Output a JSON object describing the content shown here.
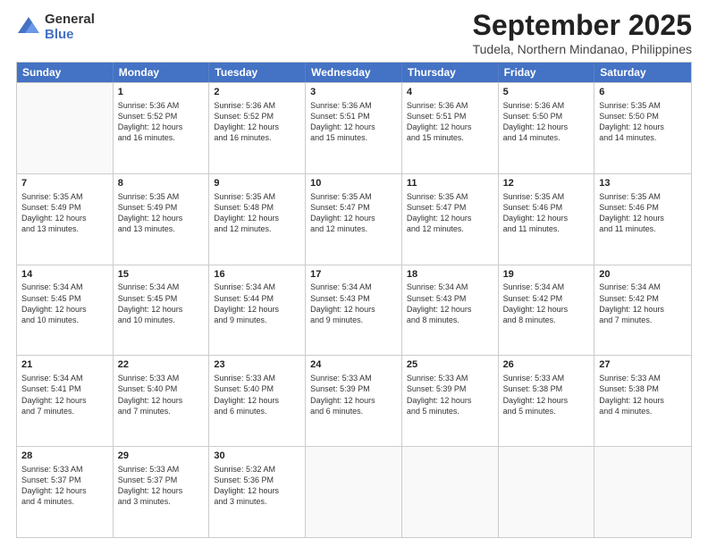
{
  "header": {
    "logo": {
      "line1": "General",
      "line2": "Blue"
    },
    "title": "September 2025",
    "subtitle": "Tudela, Northern Mindanao, Philippines"
  },
  "calendar": {
    "days_of_week": [
      "Sunday",
      "Monday",
      "Tuesday",
      "Wednesday",
      "Thursday",
      "Friday",
      "Saturday"
    ],
    "rows": [
      [
        {
          "day": "",
          "info": ""
        },
        {
          "day": "1",
          "info": "Sunrise: 5:36 AM\nSunset: 5:52 PM\nDaylight: 12 hours\nand 16 minutes."
        },
        {
          "day": "2",
          "info": "Sunrise: 5:36 AM\nSunset: 5:52 PM\nDaylight: 12 hours\nand 16 minutes."
        },
        {
          "day": "3",
          "info": "Sunrise: 5:36 AM\nSunset: 5:51 PM\nDaylight: 12 hours\nand 15 minutes."
        },
        {
          "day": "4",
          "info": "Sunrise: 5:36 AM\nSunset: 5:51 PM\nDaylight: 12 hours\nand 15 minutes."
        },
        {
          "day": "5",
          "info": "Sunrise: 5:36 AM\nSunset: 5:50 PM\nDaylight: 12 hours\nand 14 minutes."
        },
        {
          "day": "6",
          "info": "Sunrise: 5:35 AM\nSunset: 5:50 PM\nDaylight: 12 hours\nand 14 minutes."
        }
      ],
      [
        {
          "day": "7",
          "info": "Sunrise: 5:35 AM\nSunset: 5:49 PM\nDaylight: 12 hours\nand 13 minutes."
        },
        {
          "day": "8",
          "info": "Sunrise: 5:35 AM\nSunset: 5:49 PM\nDaylight: 12 hours\nand 13 minutes."
        },
        {
          "day": "9",
          "info": "Sunrise: 5:35 AM\nSunset: 5:48 PM\nDaylight: 12 hours\nand 12 minutes."
        },
        {
          "day": "10",
          "info": "Sunrise: 5:35 AM\nSunset: 5:47 PM\nDaylight: 12 hours\nand 12 minutes."
        },
        {
          "day": "11",
          "info": "Sunrise: 5:35 AM\nSunset: 5:47 PM\nDaylight: 12 hours\nand 12 minutes."
        },
        {
          "day": "12",
          "info": "Sunrise: 5:35 AM\nSunset: 5:46 PM\nDaylight: 12 hours\nand 11 minutes."
        },
        {
          "day": "13",
          "info": "Sunrise: 5:35 AM\nSunset: 5:46 PM\nDaylight: 12 hours\nand 11 minutes."
        }
      ],
      [
        {
          "day": "14",
          "info": "Sunrise: 5:34 AM\nSunset: 5:45 PM\nDaylight: 12 hours\nand 10 minutes."
        },
        {
          "day": "15",
          "info": "Sunrise: 5:34 AM\nSunset: 5:45 PM\nDaylight: 12 hours\nand 10 minutes."
        },
        {
          "day": "16",
          "info": "Sunrise: 5:34 AM\nSunset: 5:44 PM\nDaylight: 12 hours\nand 9 minutes."
        },
        {
          "day": "17",
          "info": "Sunrise: 5:34 AM\nSunset: 5:43 PM\nDaylight: 12 hours\nand 9 minutes."
        },
        {
          "day": "18",
          "info": "Sunrise: 5:34 AM\nSunset: 5:43 PM\nDaylight: 12 hours\nand 8 minutes."
        },
        {
          "day": "19",
          "info": "Sunrise: 5:34 AM\nSunset: 5:42 PM\nDaylight: 12 hours\nand 8 minutes."
        },
        {
          "day": "20",
          "info": "Sunrise: 5:34 AM\nSunset: 5:42 PM\nDaylight: 12 hours\nand 7 minutes."
        }
      ],
      [
        {
          "day": "21",
          "info": "Sunrise: 5:34 AM\nSunset: 5:41 PM\nDaylight: 12 hours\nand 7 minutes."
        },
        {
          "day": "22",
          "info": "Sunrise: 5:33 AM\nSunset: 5:40 PM\nDaylight: 12 hours\nand 7 minutes."
        },
        {
          "day": "23",
          "info": "Sunrise: 5:33 AM\nSunset: 5:40 PM\nDaylight: 12 hours\nand 6 minutes."
        },
        {
          "day": "24",
          "info": "Sunrise: 5:33 AM\nSunset: 5:39 PM\nDaylight: 12 hours\nand 6 minutes."
        },
        {
          "day": "25",
          "info": "Sunrise: 5:33 AM\nSunset: 5:39 PM\nDaylight: 12 hours\nand 5 minutes."
        },
        {
          "day": "26",
          "info": "Sunrise: 5:33 AM\nSunset: 5:38 PM\nDaylight: 12 hours\nand 5 minutes."
        },
        {
          "day": "27",
          "info": "Sunrise: 5:33 AM\nSunset: 5:38 PM\nDaylight: 12 hours\nand 4 minutes."
        }
      ],
      [
        {
          "day": "28",
          "info": "Sunrise: 5:33 AM\nSunset: 5:37 PM\nDaylight: 12 hours\nand 4 minutes."
        },
        {
          "day": "29",
          "info": "Sunrise: 5:33 AM\nSunset: 5:37 PM\nDaylight: 12 hours\nand 3 minutes."
        },
        {
          "day": "30",
          "info": "Sunrise: 5:32 AM\nSunset: 5:36 PM\nDaylight: 12 hours\nand 3 minutes."
        },
        {
          "day": "",
          "info": ""
        },
        {
          "day": "",
          "info": ""
        },
        {
          "day": "",
          "info": ""
        },
        {
          "day": "",
          "info": ""
        }
      ]
    ]
  }
}
